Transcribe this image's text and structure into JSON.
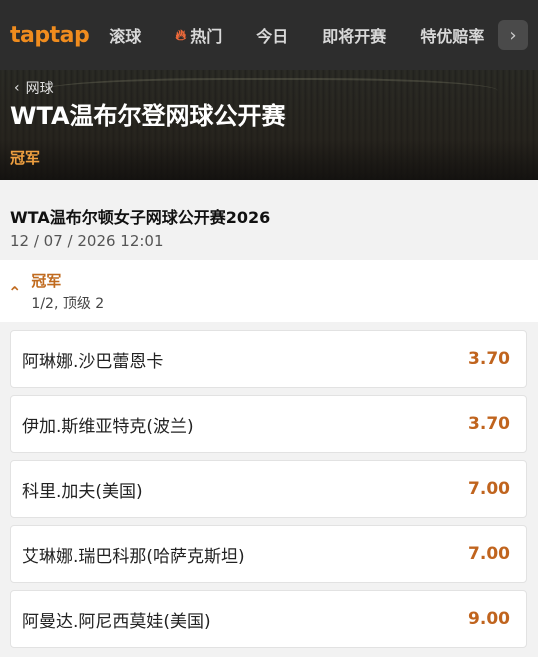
{
  "nav": {
    "logo": "taptap",
    "items": [
      {
        "label": "滚球",
        "icon": ""
      },
      {
        "label": "热门",
        "icon": "fire-icon"
      },
      {
        "label": "今日",
        "icon": ""
      },
      {
        "label": "即将开赛",
        "icon": ""
      },
      {
        "label": "特优赔率",
        "icon": ""
      }
    ],
    "scroll_icon": "chevron-right-icon"
  },
  "hero": {
    "breadcrumb": "网球",
    "title": "WTA温布尔登网球公开赛",
    "subtitle": "冠军"
  },
  "event": {
    "name": "WTA温布尔顿女子网球公开赛2026",
    "datetime": "12 / 07 / 2026 12:01"
  },
  "market": {
    "title": "冠军",
    "subtitle": "1/2, 顶级 2",
    "options": [
      {
        "name": "阿琳娜.沙巴蕾恩卡",
        "odds": "3.70"
      },
      {
        "name": "伊加.斯维亚特克(波兰)",
        "odds": "3.70"
      },
      {
        "name": "科里.加夫(美国)",
        "odds": "7.00"
      },
      {
        "name": "艾琳娜.瑞巴科那(哈萨克斯坦)",
        "odds": "7.00"
      },
      {
        "name": "阿曼达.阿尼西莫娃(美国)",
        "odds": "9.00"
      }
    ]
  },
  "colors": {
    "brand": "#f08c1e",
    "odds": "#c0641e",
    "nav_bg": "#2d2d2d"
  }
}
